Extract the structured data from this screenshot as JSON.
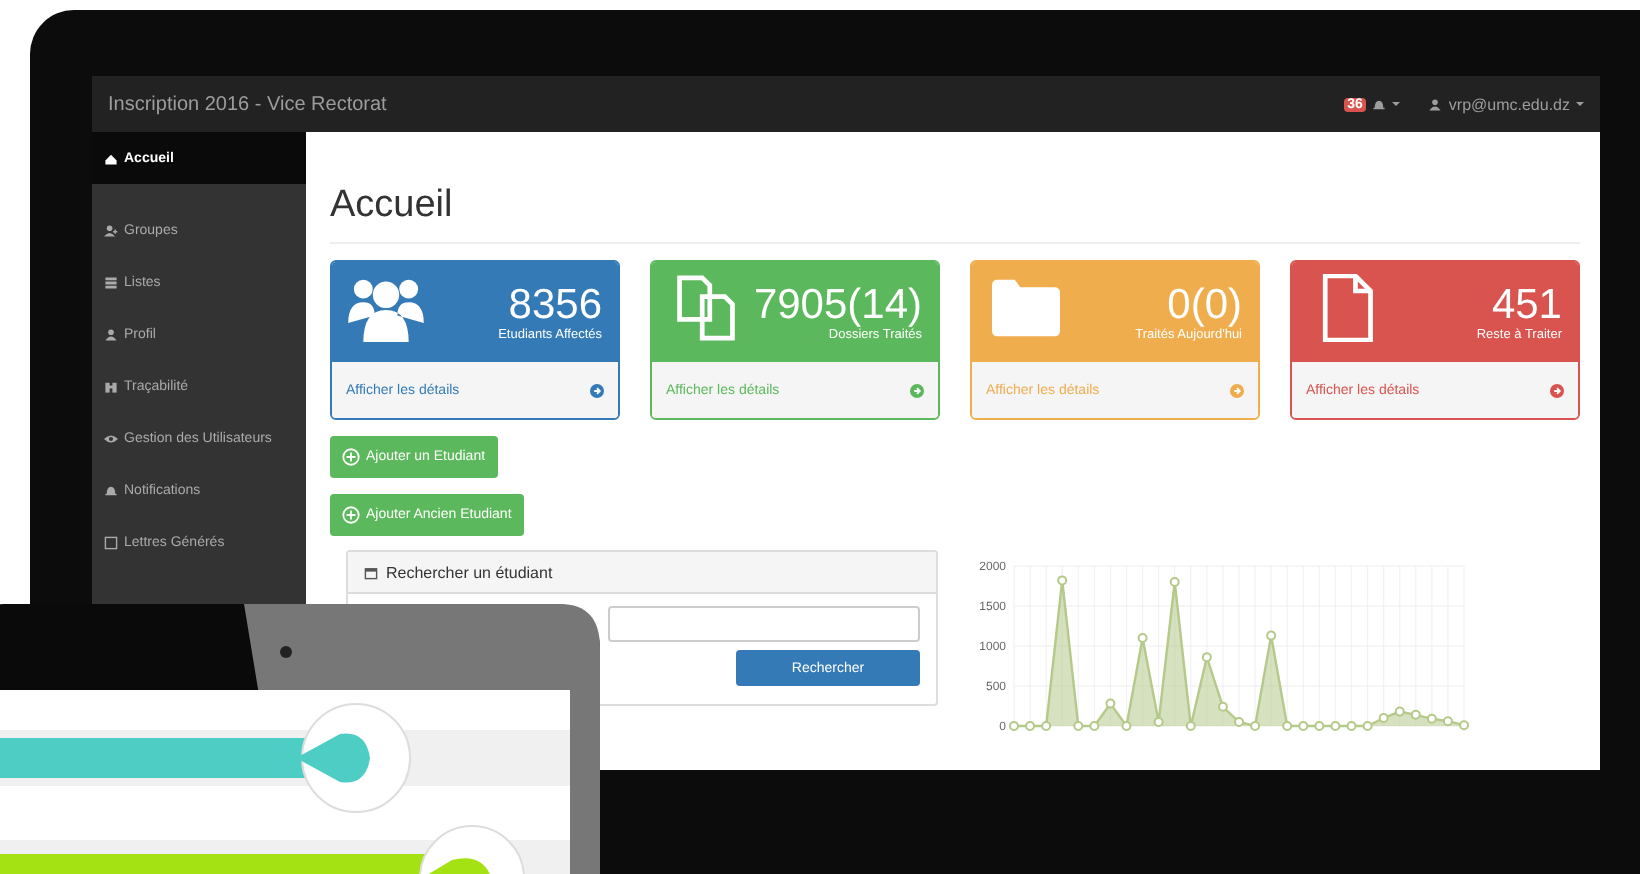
{
  "navbar": {
    "title": "Inscription 2016 -  Vice Rectorat",
    "badge": "36",
    "user": "vrp@umc.edu.dz"
  },
  "sidebar": {
    "items": [
      {
        "label": "Accueil",
        "selected": true
      },
      {
        "label": "Groupes",
        "selected": false
      },
      {
        "label": "Listes",
        "selected": false
      },
      {
        "label": "Profil",
        "selected": false
      },
      {
        "label": "Traçabilité",
        "selected": false
      },
      {
        "label": "Gestion des Utilisateurs",
        "selected": false
      },
      {
        "label": "Notifications",
        "selected": false
      },
      {
        "label": "Lettres Générés",
        "selected": false
      }
    ]
  },
  "page_title": "Accueil",
  "cards": [
    {
      "value": "8356",
      "label": "Etudiants Affectés",
      "link": "Afficher les détails",
      "color": "#337ab7"
    },
    {
      "value": "7905(14)",
      "label": "Dossiers Traités",
      "link": "Afficher les détails",
      "color": "#5cb85c"
    },
    {
      "value": "0(0)",
      "label": "Traités Aujourd'hui",
      "link": "Afficher les détails",
      "color": "#f0ad4e"
    },
    {
      "value": "451",
      "label": "Reste à Traiter",
      "link": "Afficher les détails",
      "color": "#d9534f"
    }
  ],
  "buttons": [
    "Ajouter un Etudiant",
    "Ajouter Ancien Etudiant"
  ],
  "search_panel": {
    "title": "Rechercher un étudiant",
    "button": "Rechercher"
  },
  "chart": {
    "chart_data": {
      "type": "area",
      "grid": true,
      "yticks": [
        0,
        500,
        1000,
        1500,
        2000
      ],
      "ylim": [
        0,
        2000
      ],
      "series": [
        {
          "color": "#b5c98a",
          "values": [
            0,
            0,
            0,
            1820,
            0,
            0,
            280,
            0,
            1100,
            50,
            1800,
            0,
            860,
            240,
            50,
            0,
            1130,
            0,
            0,
            0,
            0,
            0,
            0,
            100,
            180,
            140,
            90,
            60,
            10
          ]
        }
      ]
    }
  }
}
